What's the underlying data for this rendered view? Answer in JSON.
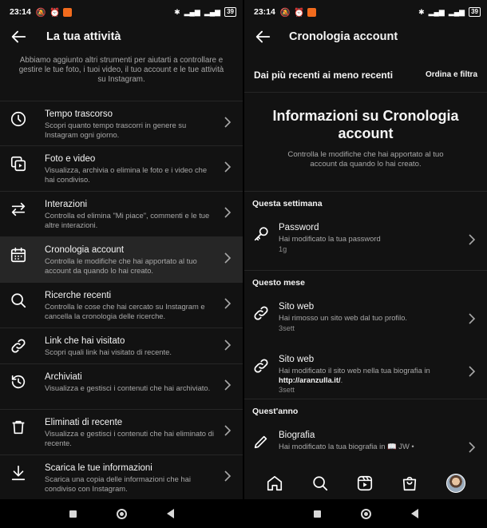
{
  "status_left": {
    "time": "23:14",
    "battery": "39"
  },
  "status_right": {
    "time": "23:14",
    "battery": "39"
  },
  "left": {
    "title": "La tua attività",
    "intro": "Abbiamo aggiunto altri strumenti per aiutarti a controllare e gestire le tue foto, i tuoi video, il tuo account e le tue attività su Instagram.",
    "items": [
      {
        "title": "Tempo trascorso",
        "sub": "Scopri quanto tempo trascorri in genere su Instagram ogni giorno.",
        "icon": "clock-icon"
      },
      {
        "title": "Foto e video",
        "sub": "Visualizza, archivia o elimina le foto e i video che hai condiviso.",
        "icon": "photo-video-icon"
      },
      {
        "title": "Interazioni",
        "sub": "Controlla ed elimina \"Mi piace\", commenti e le tue altre interazioni.",
        "icon": "arrows-icon"
      },
      {
        "title": "Cronologia account",
        "sub": "Controlla le modifiche che hai apportato al tuo account da quando lo hai creato.",
        "icon": "calendar-icon"
      },
      {
        "title": "Ricerche recenti",
        "sub": "Controlla le cose che hai cercato su Instagram e cancella la cronologia delle ricerche.",
        "icon": "search-icon"
      },
      {
        "title": "Link che hai visitato",
        "sub": "Scopri quali link hai visitato di recente.",
        "icon": "link-icon"
      },
      {
        "title": "Archiviati",
        "sub": "Visualizza e gestisci i contenuti che hai archiviato.",
        "icon": "archive-icon"
      },
      {
        "title": "Eliminati di recente",
        "sub": "Visualizza e gestisci i contenuti che hai eliminato di recente.",
        "icon": "trash-icon"
      },
      {
        "title": "Scarica le tue informazioni",
        "sub": "Scarica una copia delle informazioni che hai condiviso con Instagram.",
        "icon": "download-icon"
      }
    ]
  },
  "right": {
    "title": "Cronologia account",
    "sort_label": "Dai più recenti ai meno recenti",
    "filter_label": "Ordina e filtra",
    "info_title": "Informazioni su Cronologia account",
    "info_desc": "Controlla le modifiche che hai apportato al tuo account da quando lo hai creato.",
    "sections": {
      "week": "Questa settimana",
      "month": "Questo mese",
      "year": "Quest'anno"
    },
    "entries": {
      "password": {
        "title": "Password",
        "sub": "Hai modificato la tua password",
        "age": "1g"
      },
      "site1": {
        "title": "Sito web",
        "sub": "Hai rimosso un sito web dal tuo profilo.",
        "age": "3sett"
      },
      "site2": {
        "title": "Sito web",
        "sub": "Hai modificato il sito web nella tua biografia in",
        "link": "http://aranzulla.it/",
        "link_suffix": ".",
        "age": "3sett"
      },
      "bio": {
        "title": "Biografia",
        "sub": "Hai modificato la tua biografia in 📖 JW •"
      }
    }
  }
}
